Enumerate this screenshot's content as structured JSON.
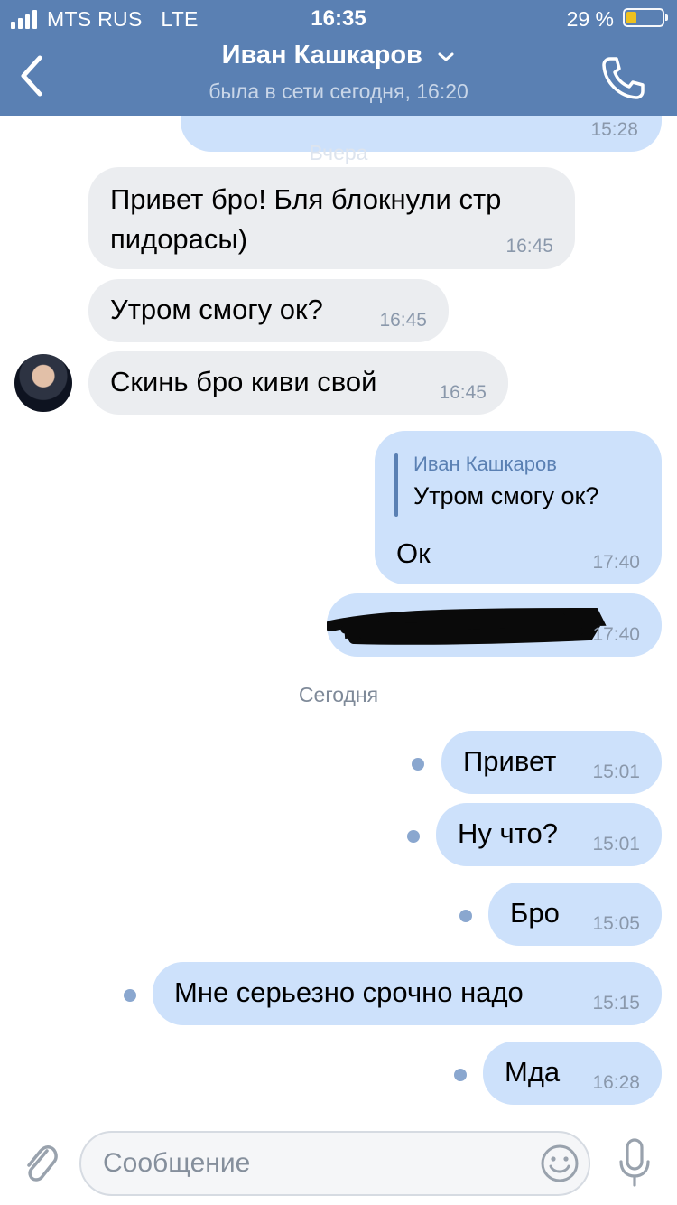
{
  "status_bar": {
    "carrier": "MTS RUS",
    "network": "LTE",
    "time": "16:35",
    "battery_percent": "29 %",
    "battery_level": 0.29
  },
  "header": {
    "contact_name": "Иван Кашкаров",
    "last_seen": "была в сети сегодня, 16:20"
  },
  "chat": {
    "top_partial_time": "15:28",
    "date_yesterday": "Вчера",
    "date_today": "Сегодня",
    "messages": [
      {
        "direction": "in",
        "text_line1": "Привет бро! Бля блокнули стр",
        "text_line2": "пидорасы)",
        "time": "16:45"
      },
      {
        "direction": "in",
        "text": "Утром смогу ок?",
        "time": "16:45"
      },
      {
        "direction": "in",
        "text": "Скинь бро киви свой",
        "time": "16:45"
      },
      {
        "direction": "out",
        "quote_author": "Иван Кашкаров",
        "quote_text": "Утром смогу ок?",
        "text": "Ок",
        "time": "17:40"
      },
      {
        "direction": "out",
        "text": "",
        "redacted": true,
        "time": "17:40"
      },
      {
        "direction": "out",
        "text": "Привет",
        "time": "15:01",
        "unread": true
      },
      {
        "direction": "out",
        "text": "Ну что?",
        "time": "15:01",
        "unread": true
      },
      {
        "direction": "out",
        "text": "Бро",
        "time": "15:05",
        "unread": true
      },
      {
        "direction": "out",
        "text": "Мне серьезно срочно надо",
        "time": "15:15",
        "unread": true
      },
      {
        "direction": "out",
        "text": "Мда",
        "time": "16:28",
        "unread": true
      }
    ]
  },
  "composer": {
    "placeholder": "Сообщение"
  },
  "colors": {
    "header_bg": "#5a80b3",
    "incoming_bubble": "#ebedf0",
    "outgoing_bubble": "#cde1fb",
    "unread_dot": "#8aa7cf"
  },
  "icons": [
    "signal-icon",
    "battery-icon",
    "back-icon",
    "chevron-down-icon",
    "phone-icon",
    "attach-icon",
    "smile-icon",
    "mic-icon"
  ]
}
